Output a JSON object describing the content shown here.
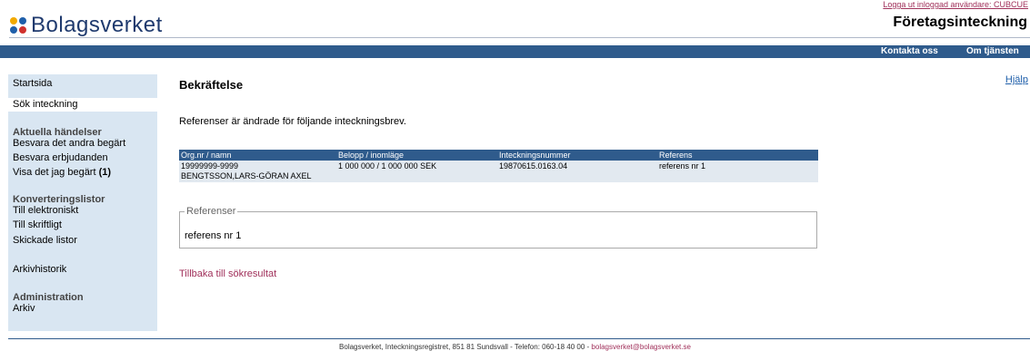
{
  "header": {
    "logo_text": "Bolagsverket",
    "logout_text": "Logga ut inloggad användare: CUBCUE",
    "service_title": "Företagsinteckning"
  },
  "nav": {
    "contact": "Kontakta oss",
    "about": "Om tjänsten"
  },
  "sidebar": {
    "start": "Startsida",
    "search": "Sök inteckning",
    "section1_title": "Aktuella händelser",
    "respond_request": "Besvara det andra begärt",
    "respond_offer": "Besvara erbjudanden",
    "show_requested": "Visa det jag begärt",
    "show_requested_count": "(1)",
    "section2_title": "Konverteringslistor",
    "to_electronic": "Till elektroniskt",
    "to_written": "Till skriftligt",
    "sent_lists": "Skickade listor",
    "archive_history": "Arkivhistorik",
    "section3_title": "Administration",
    "archive": "Arkiv"
  },
  "main": {
    "title": "Bekräftelse",
    "help": "Hjälp",
    "intro": "Referenser är ändrade för följande inteckningsbrev.",
    "table": {
      "col_org": "Org.nr / namn",
      "col_amount": "Belopp / inomläge",
      "col_number": "Inteckningsnummer",
      "col_ref": "Referens",
      "org_nr": "19999999-9999",
      "name": "BENGTSSON,LARS-GÖRAN AXEL",
      "amount": "1 000 000 / 1 000 000 SEK",
      "number": "19870615.0163.04",
      "reference": "referens nr 1"
    },
    "ref_legend": "Referenser",
    "ref_value": "referens nr 1",
    "back_link": "Tillbaka till sökresultat"
  },
  "footer": {
    "text": "Bolagsverket, Inteckningsregistret, 851 81 Sundsvall - Telefon: 060-18 40 00 -",
    "email": "bolagsverket@bolagsverket.se"
  },
  "colors": {
    "nav_blue": "#2f5b8c",
    "sidebar_bg": "#d9e6f2",
    "link_red": "#a0305a"
  }
}
